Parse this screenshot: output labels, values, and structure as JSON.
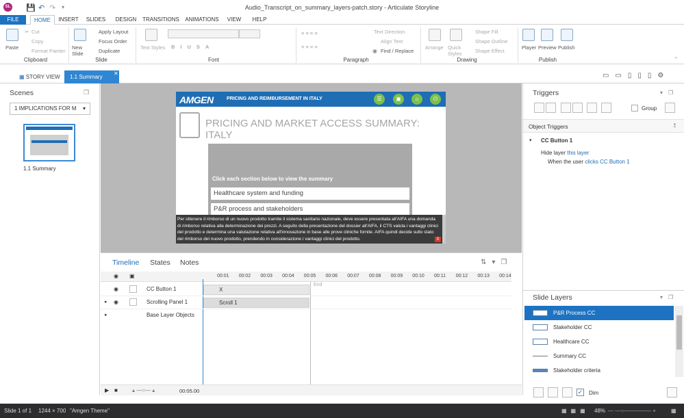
{
  "app": {
    "title": "Audio_Transcript_on_summary_layers-patch.story - Articulate Storyline",
    "logo": "SL"
  },
  "tabs": [
    "FILE",
    "HOME",
    "INSERT",
    "SLIDES",
    "DESIGN",
    "TRANSITIONS",
    "ANIMATIONS",
    "VIEW",
    "HELP"
  ],
  "ribbon": {
    "clipboard": {
      "paste": "Paste",
      "cut": "Cut",
      "copy": "Copy",
      "format_painter": "Format Painter",
      "label": "Clipboard"
    },
    "slide": {
      "new_slide": "New Slide",
      "apply_layout": "Apply Layout",
      "focus_order": "Focus Order",
      "duplicate": "Duplicate",
      "label": "Slide"
    },
    "font": {
      "text_styles": "Text Styles",
      "label": "Font"
    },
    "paragraph": {
      "text_direction": "Text Direction",
      "align_text": "Align Text",
      "find_replace": "Find / Replace",
      "label": "Paragraph"
    },
    "drawing": {
      "arrange": "Arrange",
      "quick_styles": "Quick Styles",
      "shape_fill": "Shape Fill",
      "shape_outline": "Shape Outline",
      "shape_effect": "Shape Effect",
      "label": "Drawing"
    },
    "publish": {
      "player": "Player",
      "preview": "Preview",
      "publish": "Publish",
      "label": "Publish"
    }
  },
  "view_tabs": {
    "story_view": "STORY VIEW",
    "summary": "1.1 Summary"
  },
  "scenes": {
    "title": "Scenes",
    "dropdown": "1 IMPLICATIONS FOR M",
    "thumb_label": "1.1 Summary"
  },
  "slide": {
    "logo": "AMGEN",
    "header": "PRICING AND REIMBURSEMENT IN ITALY",
    "title": "PRICING AND MARKET ACCESS SUMMARY: ITALY",
    "click_each": "Click each section below to view the summary",
    "item1": "Healthcare system and funding",
    "item2": "P&R process and stakeholders",
    "transcript": "Per ottenere il rimborso di un nuovo prodotto tramite il sistema sanitario nazionale, deve essere presentata all'AIFA una domanda di rimborso relativa alla determinazione dei prezzi. A seguito della presentazione del dossier all'AIFA, il CTS valuta i vantaggi clinici del prodotto e determina una valutazione relativa all'innovazione in base alle prove cliniche fornite. AIFA quindi decide sullo stato del rimborso del nuovo prodotto, prendendo in considerazione i vantaggi clinici del prodotto.",
    "close": "X"
  },
  "timeline": {
    "tabs": [
      "Timeline",
      "States",
      "Notes"
    ],
    "ticks": [
      "00:01",
      "00:02",
      "00:03",
      "00:04",
      "00:05",
      "00:06",
      "00:07",
      "00:08",
      "00:09",
      "00:10",
      "00:11",
      "00:12",
      "00:13",
      "00:14"
    ],
    "end": "End",
    "rows": [
      {
        "name": "CC Button 1",
        "bar": "X"
      },
      {
        "name": "Scrolling Panel 1",
        "bar": "Scroll 1"
      },
      {
        "name": "Base Layer Objects",
        "bar": ""
      }
    ],
    "duration": "00:05.00"
  },
  "triggers": {
    "title": "Triggers",
    "group": "Group",
    "object_triggers": "Object Triggers",
    "cc_button": "CC Button 1",
    "hide_layer": "Hide layer",
    "this_layer": "this layer",
    "when_user": "When the user",
    "clicks": "clicks",
    "target": "CC Button 1"
  },
  "layers": {
    "title": "Slide Layers",
    "items": [
      "P&R Process CC",
      "Stakeholder CC",
      "Healthcare CC",
      "Summary CC",
      "Stakeholder criteria"
    ],
    "dim": "Dim"
  },
  "status": {
    "slide": "Slide 1 of 1",
    "size": "1244 × 700",
    "theme": "\"Amgen Theme\"",
    "zoom": "48%"
  }
}
